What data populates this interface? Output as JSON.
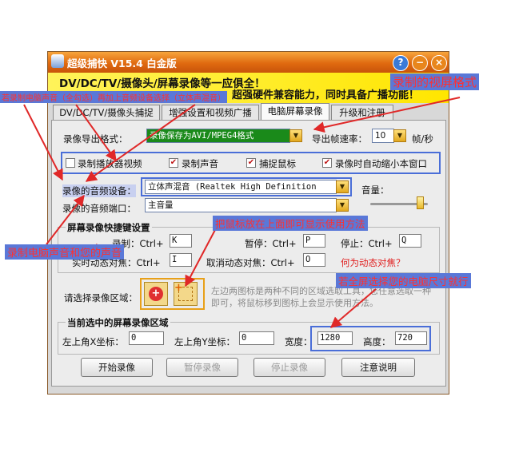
{
  "window": {
    "title": "超级捕快 V15.4 白金版",
    "help_glyph": "?",
    "min_glyph": "−",
    "close_glyph": "×"
  },
  "banner": {
    "line1": "DV/DC/TV/摄像头/屏幕录像等一应俱全！",
    "line2": "超强硬件兼容能力，同时具备广播功能！"
  },
  "tabs": [
    "DV/DC/TV/摄像头捕捉",
    "增强设置和视频广播",
    "电脑屏幕录像",
    "升级和注册"
  ],
  "active_tab": 2,
  "settings": {
    "export_format_label": "录像导出格式：",
    "export_format_value": "录像保存为AVI/MPEG4格式",
    "fps_label": "导出帧速率：",
    "fps_value": "10",
    "fps_unit": "帧/秒",
    "checkboxes": [
      {
        "label": "录制播放器视频",
        "checked": false
      },
      {
        "label": "录制声音",
        "checked": true
      },
      {
        "label": "捕捉鼠标",
        "checked": true
      },
      {
        "label": "录像时自动缩小本窗口",
        "checked": true
      }
    ],
    "check_mark": "✔",
    "audio_device_label": "录像的音频设备：",
    "audio_device_value": "立体声混音 (Realtek High Definition",
    "volume_label": "音量：",
    "audio_port_label": "录像的音频端口：",
    "audio_port_value": "主音量"
  },
  "hotkeys": {
    "title": "屏幕录像快捷键设置",
    "record_label": "录制：Ctrl+",
    "record_value": "K",
    "pause_label": "暂停：Ctrl+",
    "pause_value": "P",
    "stop_label": "停止：Ctrl+",
    "stop_value": "Q",
    "track_label": "实时动态对焦：Ctrl+",
    "track_value": "I",
    "cancel_track_label": "取消动态对焦：Ctrl+",
    "cancel_track_value": "O",
    "dynamic_link": "何为动态对焦？"
  },
  "region": {
    "select_label": "请选择录像区域：",
    "hint": "左边两图标是两种不同的区域选取工具，您任意选取一种即可，将鼠标移到图标上会显示使用方法。",
    "current_title": "当前选中的屏幕录像区域",
    "x_label": "左上角X坐标：",
    "x_value": "0",
    "y_label": "左上角Y坐标：",
    "y_value": "0",
    "width_label": "宽度：",
    "width_value": "1280",
    "height_label": "高度：",
    "height_value": "720"
  },
  "buttons": {
    "start": "开始录像",
    "pause": "暂停录像",
    "stop": "停止录像",
    "notes": "注意说明"
  },
  "annotations": {
    "top": "若录制电脑声音（全勾选）再加上音频设备选择（立体声混音）",
    "format": "录制的视屏格式",
    "hover": "把鼠标放在上面即可显示使用方法",
    "audio": "录制电脑声音和您的声音",
    "fullscreen": "若全屏选择您的电脑尺寸就行"
  },
  "colors": {
    "title_bar": "#e87a1c",
    "banner": "#ffee33",
    "highlight": "#4a6ed8",
    "annotation_text": "#ff3030",
    "annotation_bg": "#5a78d8",
    "format_combo": "#1a8a1a"
  }
}
